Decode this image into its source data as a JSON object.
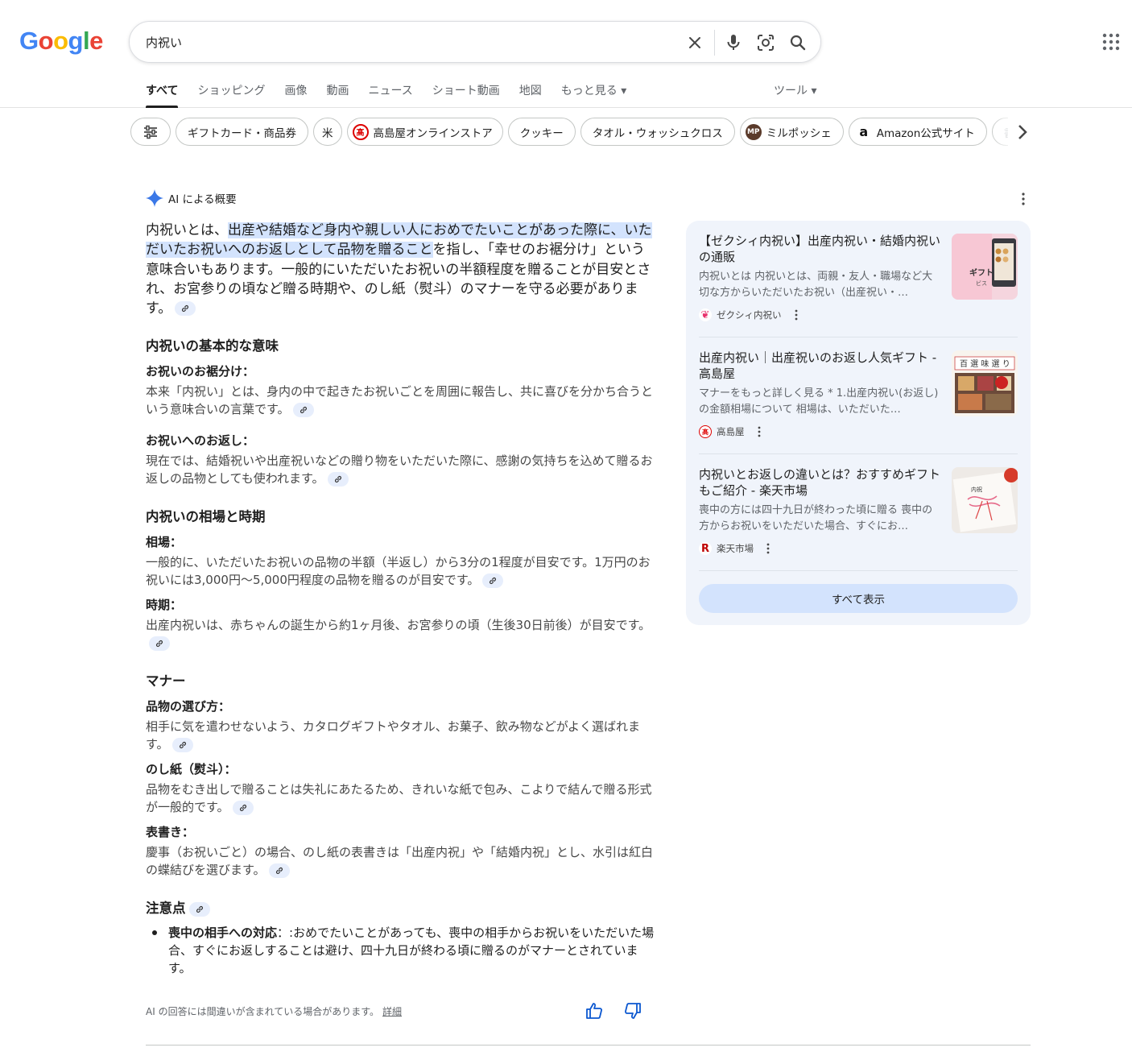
{
  "logo": {
    "g1": "G",
    "o1": "o",
    "o2": "o",
    "g2": "g",
    "l": "l",
    "e": "e"
  },
  "search": {
    "value": "内祝い"
  },
  "tabs": [
    "すべて",
    "ショッピング",
    "画像",
    "動画",
    "ニュース",
    "ショート動画",
    "地図",
    "もっと見る ▾"
  ],
  "tools": "ツール ▾",
  "chips": [
    "ギフトカード・商品券",
    "米",
    "高島屋オンラインストア",
    "クッキー",
    "タオル・ウォッシュクロス",
    "ミルポッシェ",
    "Amazon公式サイト",
    "書籍"
  ],
  "ai": {
    "label": "AI による概要",
    "lead_pre": "内祝いとは、",
    "lead_hl": "出産や結婚など身内や親しい人におめでたいことがあった際に、いただいたお祝いへのお返しとして品物を贈ること",
    "lead_post": "を指し、「幸せのお裾分け」という意味合いもあります。一般的にいただいたお祝いの半額程度を贈ることが目安とされ、お宮参りの頃など贈る時期や、のし紙（熨斗）のマナーを守る必要があります。",
    "s1": {
      "title": "内祝いの基本的な意味",
      "a_title": "お祝いのお裾分け：",
      "a_text": "本来「内祝い」とは、身内の中で起きたお祝いごとを周囲に報告し、共に喜びを分かち合うという意味合いの言葉です。",
      "b_title": "お祝いへのお返し：",
      "b_text": "現在では、結婚祝いや出産祝いなどの贈り物をいただいた際に、感謝の気持ちを込めて贈るお返しの品物としても使われます。"
    },
    "s2": {
      "title": "内祝いの相場と時期",
      "a_title": "相場：",
      "a_text": "一般的に、いただいたお祝いの品物の半額（半返し）から3分の1程度が目安です。1万円のお祝いには3,000円〜5,000円程度の品物を贈るのが目安です。",
      "b_title": "時期：",
      "b_text": "出産内祝いは、赤ちゃんの誕生から約1ヶ月後、お宮参りの頃（生後30日前後）が目安です。"
    },
    "s3": {
      "title": "マナー",
      "a_title": "品物の選び方：",
      "a_text": "相手に気を遣わせないよう、カタログギフトやタオル、お菓子、飲み物などがよく選ばれます。",
      "b_title": "のし紙（熨斗）：",
      "b_text": "品物をむき出しで贈ることは失礼にあたるため、きれいな紙で包み、こよりで結んで贈る形式が一般的です。",
      "c_title": "表書き：",
      "c_text": "慶事（お祝いごと）の場合、のし紙の表書きは「出産内祝」や「結婚内祝」とし、水引は紅白の蝶結びを選びます。"
    },
    "s4": {
      "title": "注意点",
      "bullet_title": "喪中の相手への対応",
      "bullet_text": "：:おめでたいことがあっても、喪中の相手からお祝いをいただいた場合、すぐにお返しすることは避け、四十九日が終わる頃に贈るのがマナーとされています。"
    },
    "disclaimer": "AI の回答には間違いが含まれている場合があります。",
    "details": "詳細"
  },
  "sources": [
    {
      "title": "【ゼクシィ内祝い】出産内祝い・結婚内祝いの通販",
      "snippet": "内祝いとは 内祝いとは、両親・友人・職場など大切な方からいただいたお祝い（出産祝い・…",
      "site": "ゼクシィ内祝い"
    },
    {
      "title": "出産内祝い｜出産祝いのお返し人気ギフト - 高島屋",
      "snippet": "マナーをもっと詳しく見る * 1.出産内祝い(お返し)の金額相場について 相場は、いただいた…",
      "site": "高島屋"
    },
    {
      "title": "内祝いとお返しの違いとは？おすすめギフトもご紹介 - 楽天市場",
      "snippet": "喪中の方には四十九日が終わった頃に贈る 喪中の方からお祝いをいただいた場合、すぐにお…",
      "site": "楽天市場"
    }
  ],
  "show_all": "すべて表示"
}
